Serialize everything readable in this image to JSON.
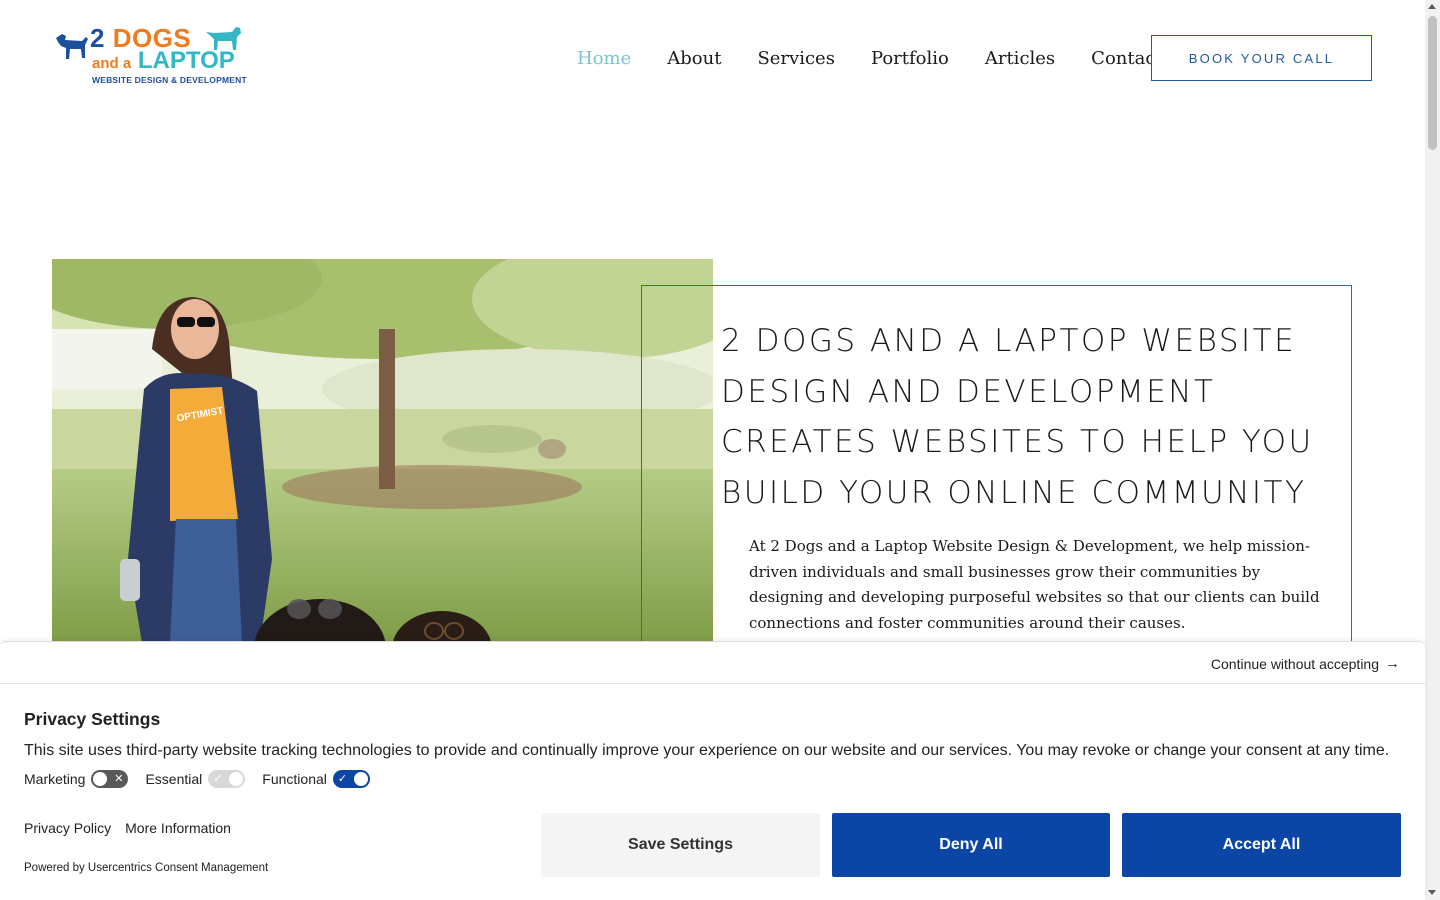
{
  "logo": {
    "line1_num": "2",
    "line1_word": "DOGS",
    "line2_and": "and a",
    "line2_word": "LAPTOP",
    "tagline": "WEBSITE DESIGN & DEVELOPMENT",
    "colors": {
      "orange": "#f07a1e",
      "teal": "#33b7c4",
      "blue": "#1c4f9c"
    }
  },
  "nav": {
    "items": [
      "Home",
      "About",
      "Services",
      "Portfolio",
      "Articles",
      "Contact"
    ],
    "active": "Home",
    "active_color": "#7cc3cf"
  },
  "cta": {
    "label": "BOOK YOUR CALL",
    "color": "#1f5a9e"
  },
  "hero": {
    "title": "2 Dogs and a Laptop Website Design and Development Creates Websites to Help You Build Your Online Community",
    "body": "At 2 Dogs and a Laptop Website Design & Development, we help mission-driven individuals and small businesses grow their communities by designing and developing purposeful websites so that our clients can build connections and foster communities around their causes.",
    "shirt_text": "OPTIMIST",
    "box_color": "#2a6f95"
  },
  "consent": {
    "continue_label": "Continue without accepting",
    "continue_icon": "arrow-right-icon",
    "title": "Privacy Settings",
    "text": "This site uses third-party website tracking technologies to provide and continually improve your experience on our website and our services. You may revoke or change your consent at any time.",
    "toggles": [
      {
        "label": "Marketing",
        "state": "off"
      },
      {
        "label": "Essential",
        "state": "on-disabled"
      },
      {
        "label": "Functional",
        "state": "on"
      }
    ],
    "links": [
      "Privacy Policy",
      "More Information"
    ],
    "powered_by": "Powered by Usercentrics Consent Management",
    "buttons": {
      "save": "Save Settings",
      "deny": "Deny All",
      "accept": "Accept All"
    },
    "button_color": "#0b45a6"
  }
}
